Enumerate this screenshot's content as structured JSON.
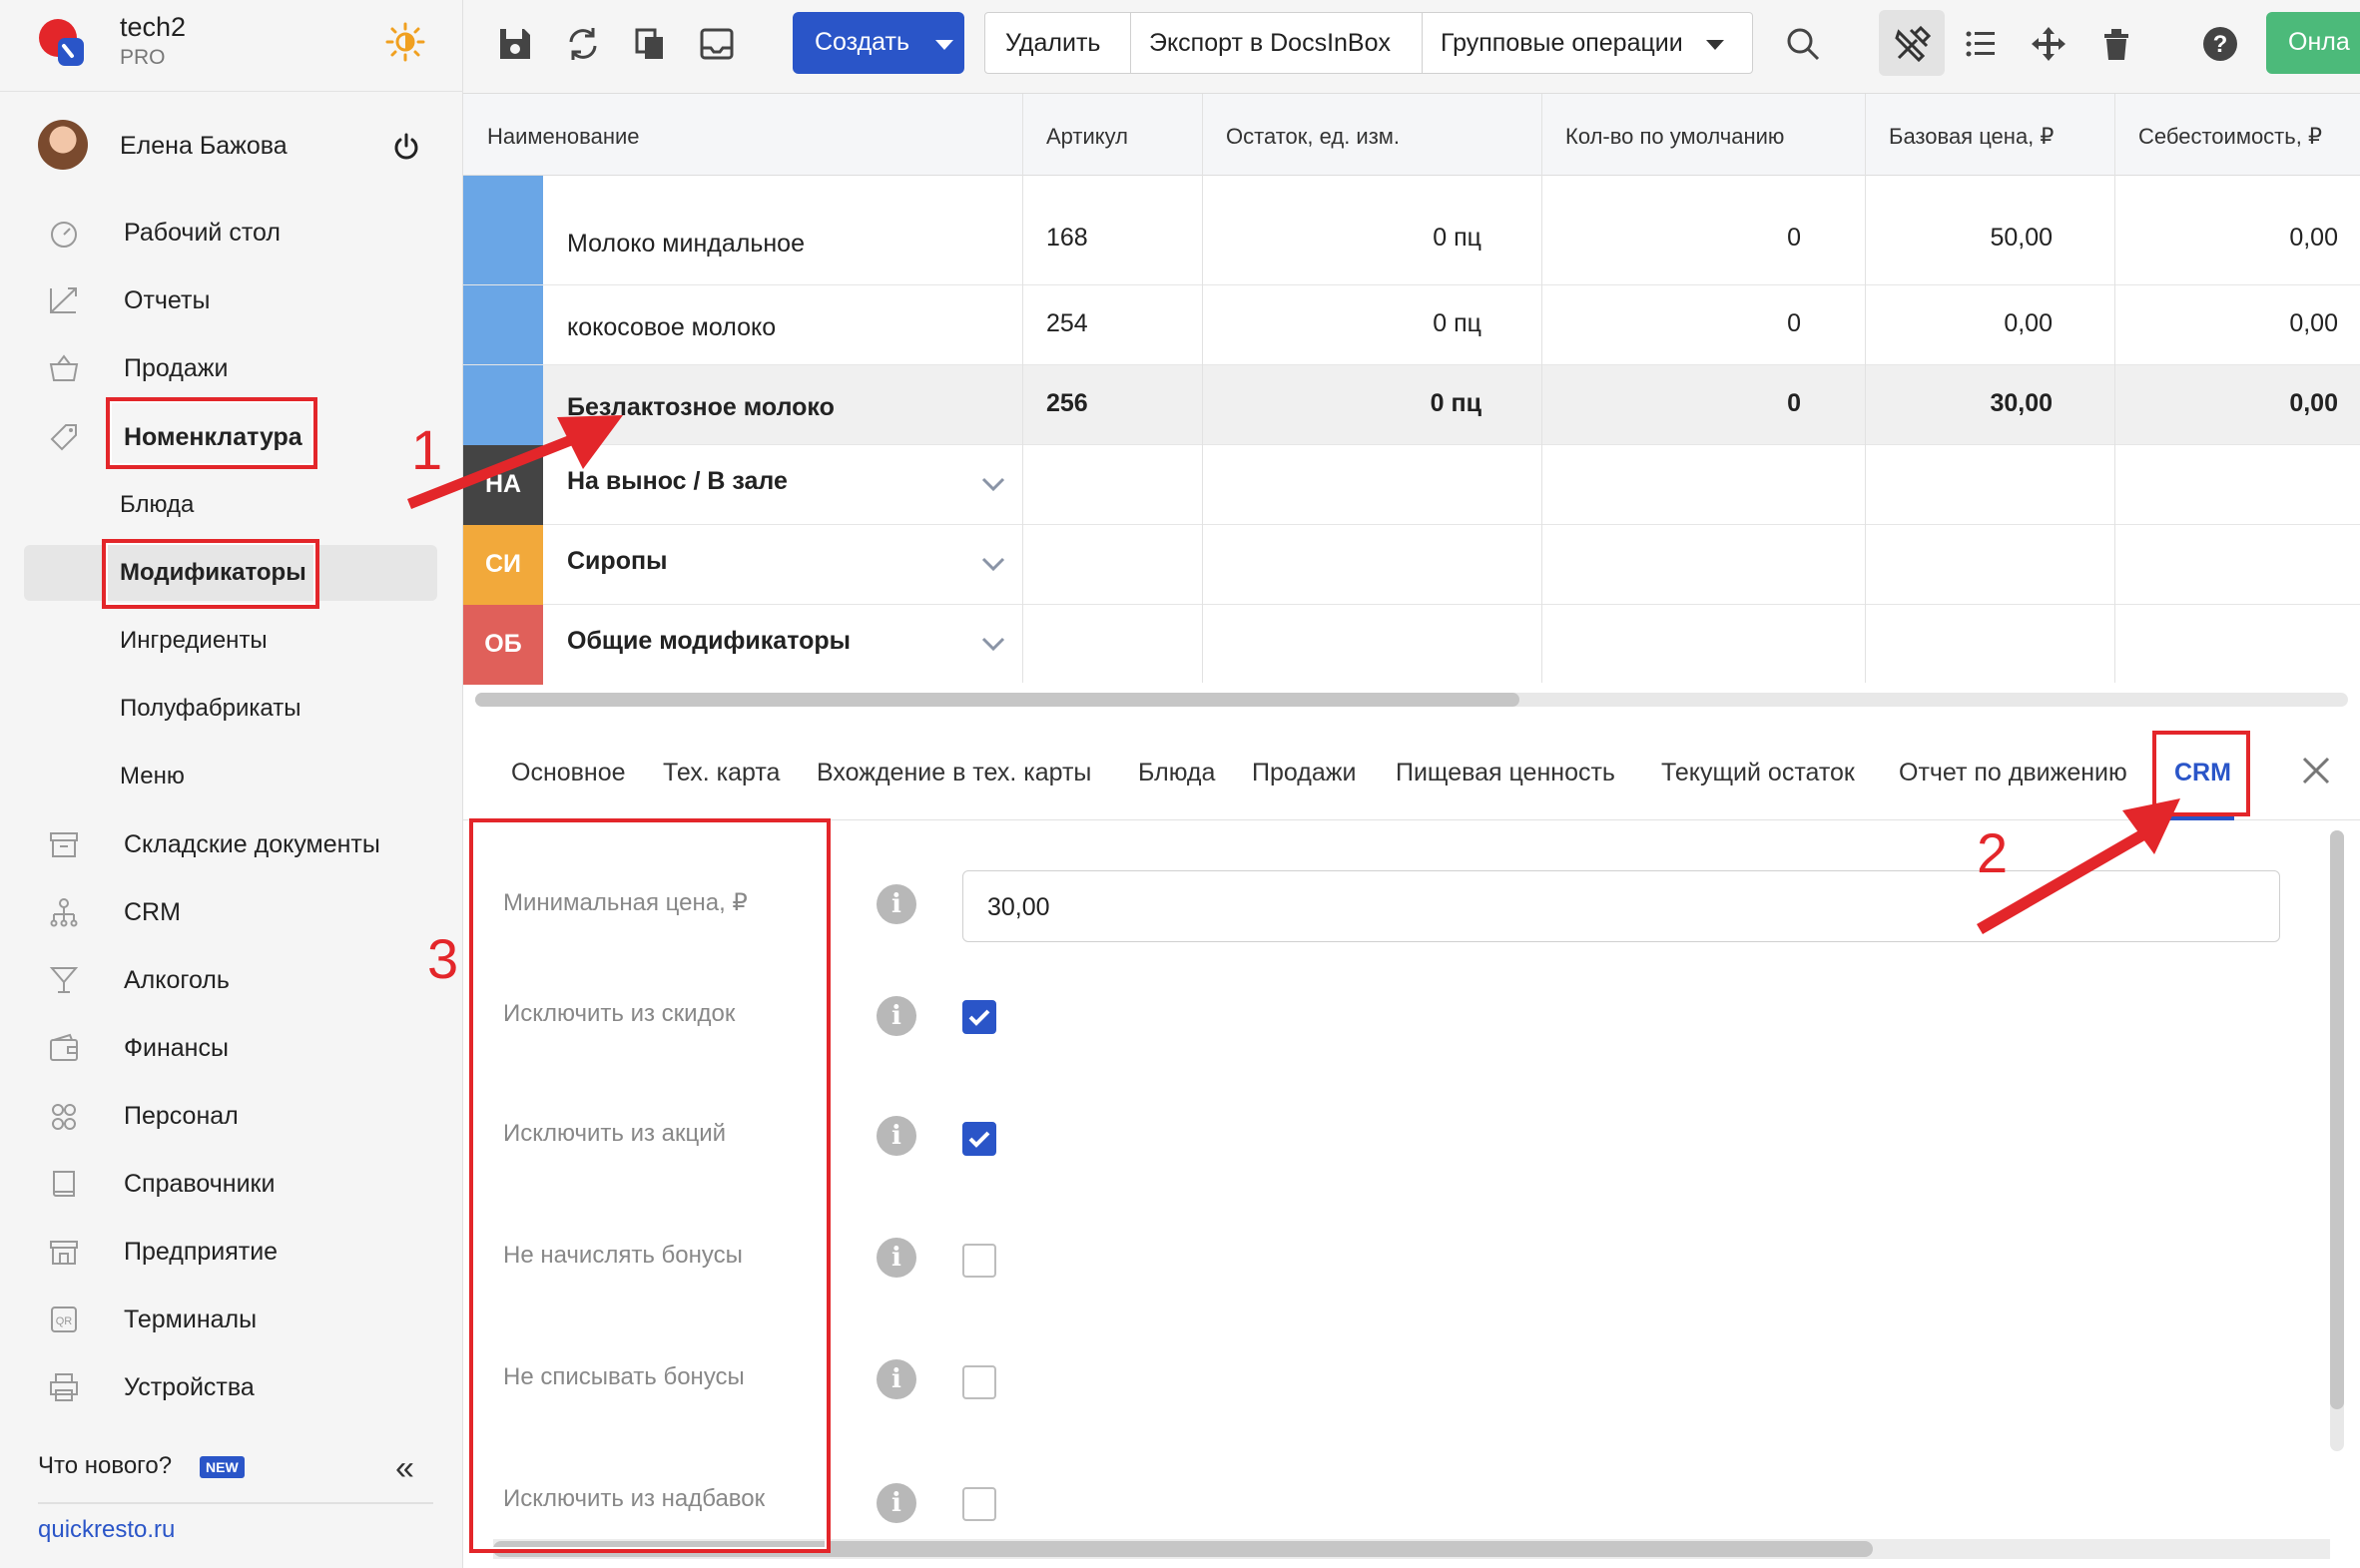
{
  "brand": {
    "name": "tech2",
    "plan": "PRO"
  },
  "user": {
    "name": "Елена Бажова"
  },
  "sidebar": {
    "items": [
      {
        "label": "Рабочий стол",
        "icon": "dashboard-icon"
      },
      {
        "label": "Отчеты",
        "icon": "reports-icon"
      },
      {
        "label": "Продажи",
        "icon": "basket-icon"
      },
      {
        "label": "Номенклатура",
        "icon": "tag-icon"
      }
    ],
    "sub_items": [
      {
        "label": "Блюда"
      },
      {
        "label": "Модификаторы",
        "active": true
      },
      {
        "label": "Ингредиенты"
      },
      {
        "label": "Полуфабрикаты"
      },
      {
        "label": "Меню"
      }
    ],
    "items_more": [
      {
        "label": "Складские документы",
        "icon": "warehouse-icon"
      },
      {
        "label": "CRM",
        "icon": "crm-icon"
      },
      {
        "label": "Алкоголь",
        "icon": "cocktail-icon"
      },
      {
        "label": "Финансы",
        "icon": "wallet-icon"
      },
      {
        "label": "Персонал",
        "icon": "people-icon"
      },
      {
        "label": "Справочники",
        "icon": "book-icon"
      },
      {
        "label": "Предприятие",
        "icon": "store-icon"
      },
      {
        "label": "Терминалы",
        "icon": "qr-icon"
      },
      {
        "label": "Устройства",
        "icon": "printer-icon"
      }
    ],
    "whats_new": "Что нового?",
    "new_badge": "NEW",
    "site": "quickresto.ru"
  },
  "toolbar": {
    "create_label": "Создать",
    "delete_label": "Удалить",
    "export_label": "Экспорт в DocsInBox",
    "group_ops_label": "Групповые операции",
    "online_label": "Онла"
  },
  "table": {
    "columns": [
      "Наименование",
      "Артикул",
      "Остаток, ед. изм.",
      "Кол-во по умолчанию",
      "Базовая цена, ₽",
      "Себестоимость, ₽"
    ],
    "rows": [
      {
        "name": "Молоко миндальное",
        "article": "168",
        "stock": "0 пц",
        "default_qty": "0",
        "base_price": "50,00",
        "cost": "0,00"
      },
      {
        "name": "кокосовое молоко",
        "article": "254",
        "stock": "0 пц",
        "default_qty": "0",
        "base_price": "0,00",
        "cost": "0,00"
      },
      {
        "name": "Безлактозное молоко",
        "article": "256",
        "stock": "0 пц",
        "default_qty": "0",
        "base_price": "30,00",
        "cost": "0,00",
        "selected": true
      }
    ],
    "groups": [
      {
        "tag": "НА",
        "name": "На вынос / В зале",
        "color": "#444444"
      },
      {
        "tag": "СИ",
        "name": "Сиропы",
        "color": "#f2a93b"
      },
      {
        "tag": "ОБ",
        "name": "Общие модификаторы",
        "color": "#e0605a"
      }
    ]
  },
  "tabs": [
    "Основное",
    "Тех. карта",
    "Вхождение в тех. карты",
    "Блюда",
    "Продажи",
    "Пищевая ценность",
    "Текущий остаток",
    "Отчет по движению",
    "CRM"
  ],
  "active_tab": "CRM",
  "form": {
    "min_price_label": "Минимальная цена, ₽",
    "min_price_value": "30,00",
    "fields": [
      {
        "label": "Исключить из скидок",
        "checked": true
      },
      {
        "label": "Исключить из акций",
        "checked": true
      },
      {
        "label": "Не начислять бонусы",
        "checked": false
      },
      {
        "label": "Не списывать бонусы",
        "checked": false
      },
      {
        "label": "Исключить из надбавок",
        "checked": false
      }
    ]
  },
  "annotations": {
    "n1": "1",
    "n2": "2",
    "n3": "3",
    "color": "#e3262a"
  },
  "colors": {
    "accent": "#2a55c8",
    "online": "#4cba7a",
    "sidebar_bg": "#f5f5f5"
  }
}
